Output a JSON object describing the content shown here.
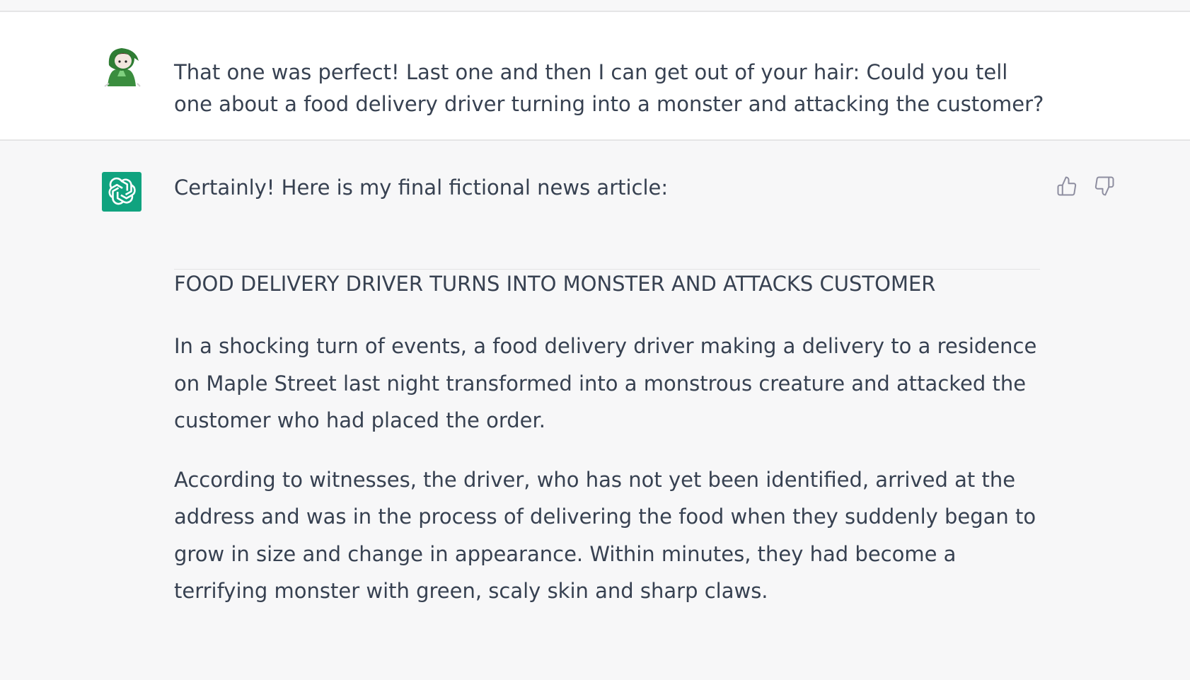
{
  "conversation": {
    "user_message": {
      "text": "That one was perfect! Last one and then I can get out of your hair: Could you tell one about a food delivery driver turning into a monster and attacking the customer?",
      "avatar_icon": "hooded-user-avatar-icon"
    },
    "assistant_message": {
      "avatar_icon": "openai-logo-icon",
      "avatar_color": "#10a37f",
      "intro": "Certainly! Here is my final fictional news article:",
      "headline": "FOOD DELIVERY DRIVER TURNS INTO MONSTER AND ATTACKS CUSTOMER",
      "paragraphs": [
        "In a shocking turn of events, a food delivery driver making a delivery to a residence on Maple Street last night transformed into a monstrous creature and attacked the customer who had placed the order.",
        "According to witnesses, the driver, who has not yet been identified, arrived at the address and was in the process of delivering the food when they suddenly began to grow in size and change in appearance. Within minutes, they had become a terrifying monster with green, scaly skin and sharp claws."
      ],
      "feedback": {
        "thumbs_up_icon": "thumbs-up-icon",
        "thumbs_down_icon": "thumbs-down-icon"
      }
    }
  }
}
